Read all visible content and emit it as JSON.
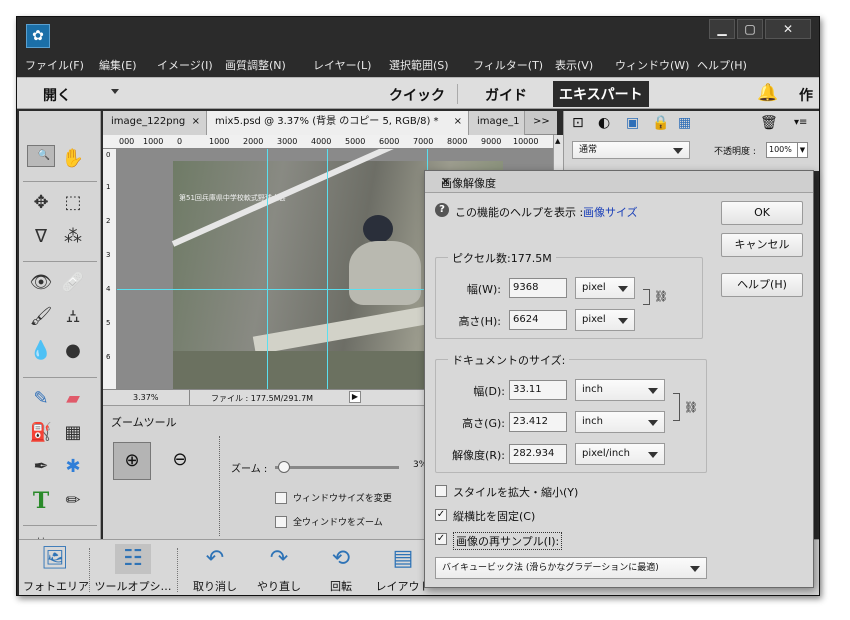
{
  "menubar": {
    "items": [
      "ファイル(F)",
      "編集(E)",
      "イメージ(I)",
      "画質調整(N)",
      "レイヤー(L)",
      "選択範囲(S)",
      "フィルター(T)",
      "表示(V)",
      "ウィンドウ(W)",
      "ヘルプ(H)"
    ]
  },
  "window_controls": {
    "minimize": "▁",
    "maximize": "▢",
    "close": "✕"
  },
  "modebar": {
    "open": "開く",
    "quick": "クイック",
    "guide": "ガイド",
    "expert": "エキスパート",
    "create": "作"
  },
  "doc_tabs": [
    {
      "label": "image_122png",
      "close": "×"
    },
    {
      "label": "mix5.psd @ 3.37% (背景 のコピー 5, RGB/8) *",
      "close": "×"
    },
    {
      "label": "image_1"
    }
  ],
  "doc_tabs_more": ">>",
  "ruler_h": [
    "000",
    "1000",
    "0",
    "1000",
    "2000",
    "3000",
    "4000",
    "5000",
    "6000",
    "7000",
    "8000",
    "9000",
    "10000"
  ],
  "ruler_v": [
    "0",
    "1",
    "2",
    "3",
    "4",
    "5",
    "6"
  ],
  "photo_caption": "第51回兵庫県中学校軟式野球大会",
  "status": {
    "zoom": "3.37%",
    "file": "ファイル : 177.5M/291.7M"
  },
  "layers_panel": {
    "blend_mode": "通常",
    "opacity_label": "不透明度 :",
    "opacity_value": "100%"
  },
  "tool_options": {
    "title": "ズームツール",
    "zoom_label": "ズーム :",
    "zoom_value": "3%",
    "zoom_level": 0.03,
    "resize_windows": "ウィンドウサイズを変更",
    "zoom_all": "全ウィンドウをズーム"
  },
  "bottom_bar": [
    "フォトエリア",
    "ツールオプシ…",
    "取り消し",
    "やり直し",
    "回転",
    "レイアウト"
  ],
  "dialog": {
    "title": "画像解像度",
    "help_text": "この機能のヘルプを表示 :",
    "help_link": "画像サイズ",
    "ok": "OK",
    "cancel": "キャンセル",
    "help_button": "ヘルプ(H)",
    "pixel_group": "ピクセル数:177.5M",
    "width_label": "幅(W):",
    "width_value": "9368",
    "width_unit": "pixel",
    "height_label": "高さ(H):",
    "height_value": "6624",
    "height_unit": "pixel",
    "doc_group": "ドキュメントのサイズ:",
    "doc_width_label": "幅(D):",
    "doc_width_value": "33.11",
    "doc_width_unit": "inch",
    "doc_height_label": "高さ(G):",
    "doc_height_value": "23.412",
    "doc_height_unit": "inch",
    "resolution_label": "解像度(R):",
    "resolution_value": "282.934",
    "resolution_unit": "pixel/inch",
    "scale_styles": "スタイルを拡大・縮小(Y)",
    "scale_styles_checked": false,
    "constrain": "縦横比を固定(C)",
    "constrain_checked": true,
    "resample": "画像の再サンプル(I):",
    "resample_checked": true,
    "resample_method": "バイキュービック法 (滑らかなグラデーションに最適)"
  }
}
